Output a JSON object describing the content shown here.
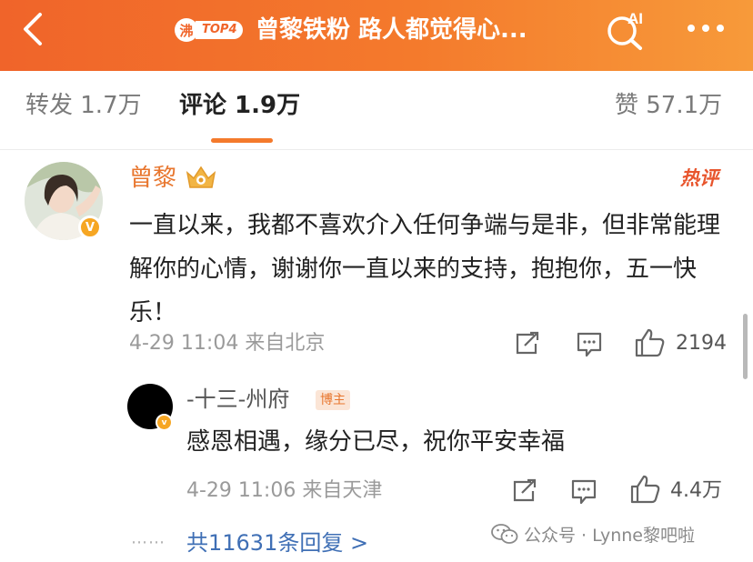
{
  "header": {
    "badge_icon": "沸",
    "badge_text": "TOP4",
    "title": "曾黎铁粉 路人都觉得心...",
    "ai_label": "AI",
    "gradient": [
      "#f0642a",
      "#f79a3a"
    ]
  },
  "tabs": {
    "repost": "转发 1.7万",
    "comment": "评论 1.9万",
    "like": "赞 57.1万",
    "active": "comment",
    "accent": "#f47a2c"
  },
  "comment": {
    "name": "曾黎",
    "hot_label": "热评",
    "verified_icon": "V",
    "text": "一直以来，我都不喜欢介入任何争端与是非，但非常能理解你的心情，谢谢你一直以来的支持，抱抱你，五一快乐！",
    "meta": "4-29 11:04 来自北京",
    "likes": "2194",
    "name_color": "#e8762e"
  },
  "reply": {
    "name": "-十三-州府",
    "tag": "博主",
    "verified_icon": "v",
    "text": "感恩相遇，缘分已尽，祝你平安幸福",
    "meta": "4-29 11:06 来自天津",
    "likes": "4.4万"
  },
  "more_replies": {
    "dots": "⋯⋯",
    "text": "共11631条回复 >"
  },
  "watermark": {
    "text": "公众号 · Lynne黎吧啦"
  },
  "icons": [
    "back-icon",
    "fire-badge-icon",
    "ai-search-icon",
    "more-icon",
    "crown-badge-icon",
    "share-icon",
    "comment-icon",
    "thumbs-up-icon",
    "wechat-icon"
  ]
}
